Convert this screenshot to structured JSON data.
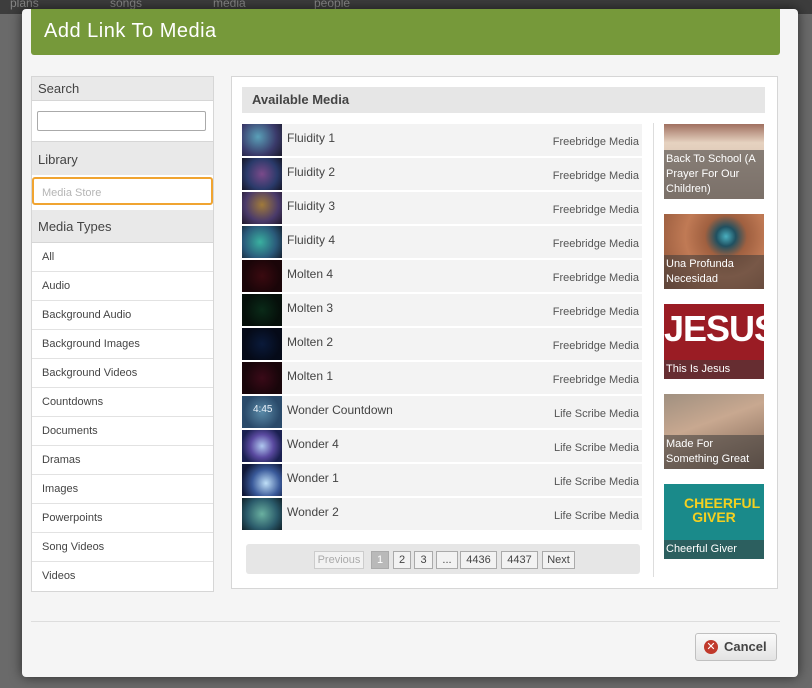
{
  "background_nav": {
    "items": [
      "plans",
      "songs",
      "media",
      "people"
    ]
  },
  "modal": {
    "title": "Add Link To Media",
    "sidebar": {
      "search_label": "Search",
      "search_value": "",
      "library_label": "Library",
      "media_store_label": "Media Store",
      "media_types_label": "Media Types",
      "types": [
        "All",
        "Audio",
        "Background Audio",
        "Background Images",
        "Background Videos",
        "Countdowns",
        "Documents",
        "Dramas",
        "Images",
        "Powerpoints",
        "Song Videos",
        "Videos"
      ]
    },
    "main": {
      "header": "Available Media",
      "items": [
        {
          "name": "Fluidity 1",
          "provider": "Freebridge Media"
        },
        {
          "name": "Fluidity 2",
          "provider": "Freebridge Media"
        },
        {
          "name": "Fluidity 3",
          "provider": "Freebridge Media"
        },
        {
          "name": "Fluidity 4",
          "provider": "Freebridge Media"
        },
        {
          "name": "Molten 4",
          "provider": "Freebridge Media"
        },
        {
          "name": "Molten 3",
          "provider": "Freebridge Media"
        },
        {
          "name": "Molten 2",
          "provider": "Freebridge Media"
        },
        {
          "name": "Molten 1",
          "provider": "Freebridge Media"
        },
        {
          "name": "Wonder Countdown",
          "provider": "Life Scribe Media",
          "thumb_text": "4:45"
        },
        {
          "name": "Wonder 4",
          "provider": "Life Scribe Media"
        },
        {
          "name": "Wonder 1",
          "provider": "Life Scribe Media"
        },
        {
          "name": "Wonder 2",
          "provider": "Life Scribe Media"
        }
      ],
      "featured": [
        {
          "caption": "Back To School (A Prayer For Our Children)"
        },
        {
          "caption": "Una Profunda Necesidad"
        },
        {
          "caption": "This Is Jesus",
          "image_text": "JESUS"
        },
        {
          "caption": "Made For Something Great"
        },
        {
          "caption": "Cheerful Giver",
          "image_text": "CHEERFUL GIVER"
        }
      ],
      "pagination": {
        "previous": "Previous",
        "pages": [
          "1",
          "2",
          "3",
          "...",
          "4436",
          "4437"
        ],
        "next": "Next",
        "current": "1"
      }
    },
    "cancel_label": "Cancel"
  }
}
